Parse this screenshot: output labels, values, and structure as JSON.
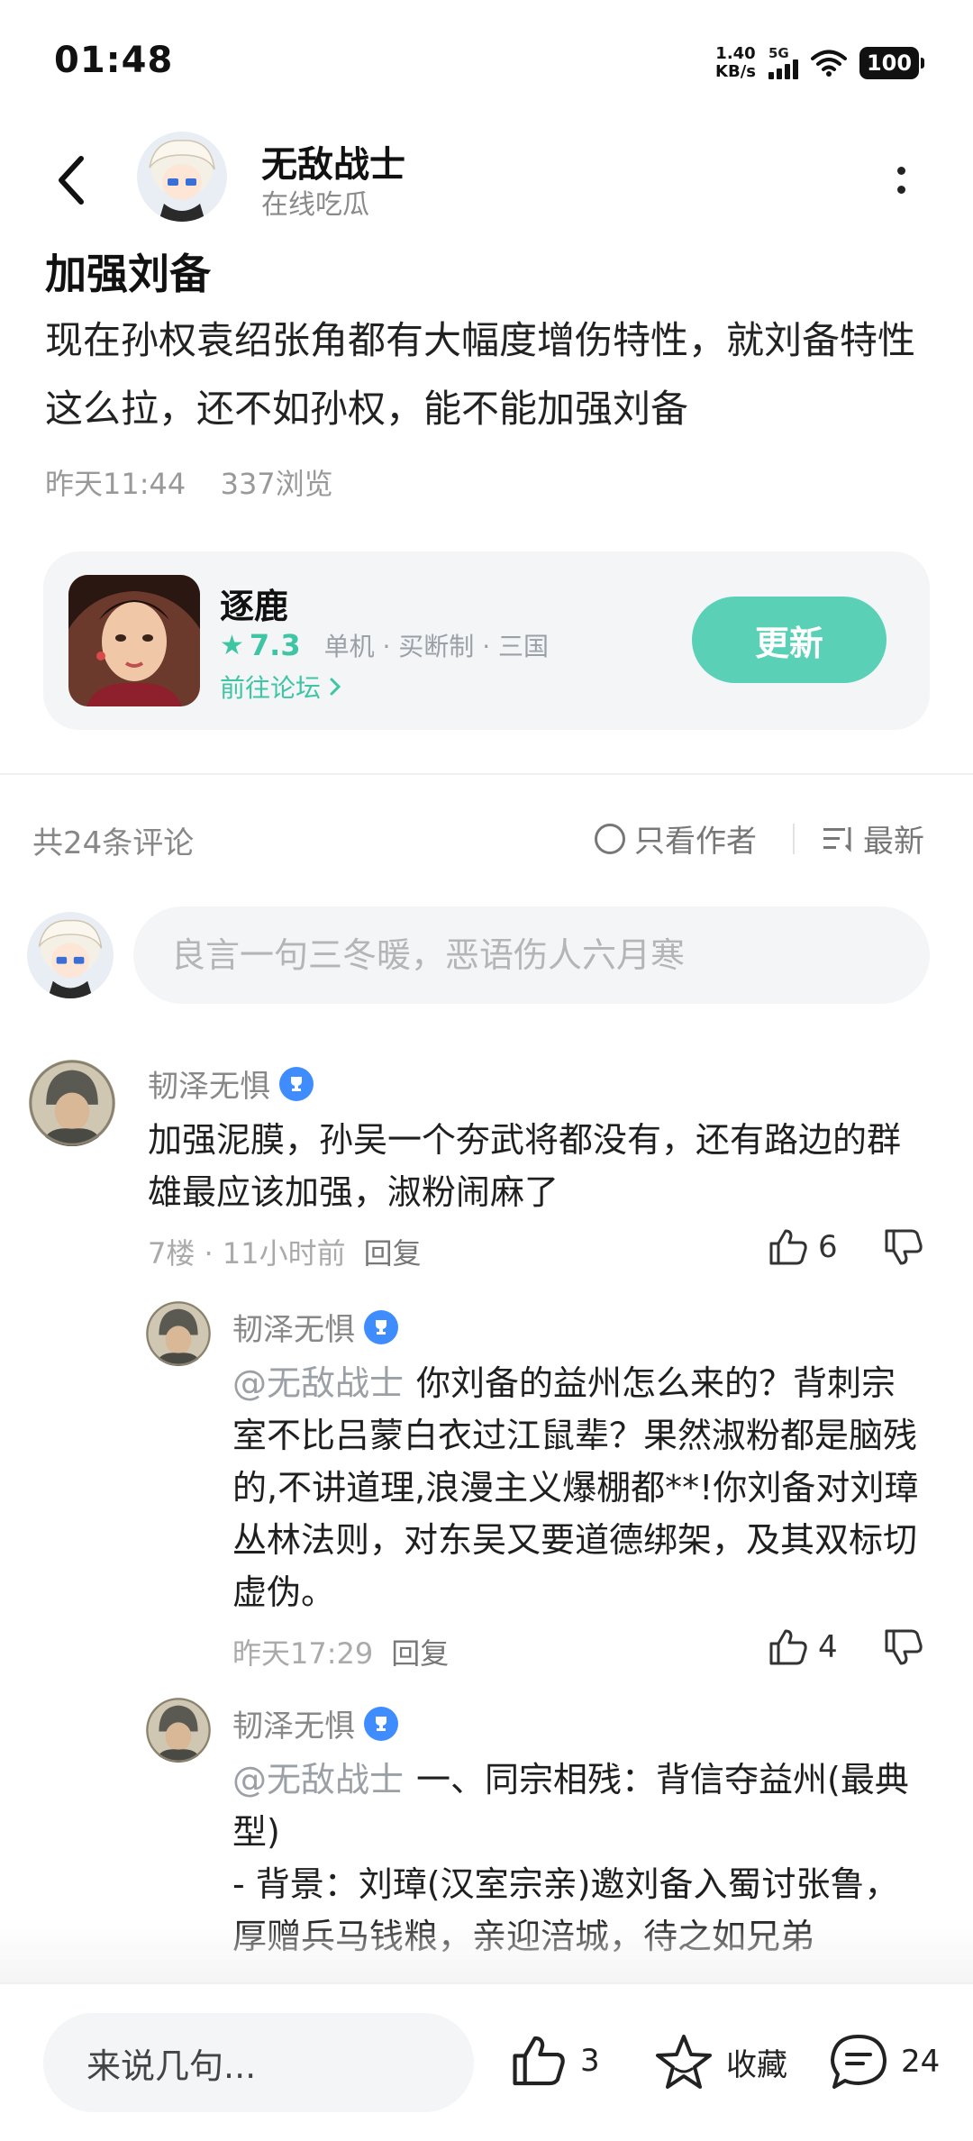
{
  "status_bar": {
    "time": "01:48",
    "speed_value": "1.40",
    "speed_unit": "KB/s",
    "network": "5G",
    "battery": "100"
  },
  "header": {
    "author_name": "无敌战士",
    "author_subtitle": "在线吃瓜"
  },
  "post": {
    "title": "加强刘备",
    "body": "现在孙权袁绍张角都有大幅度增伤特性，就刘备特性这么拉，还不如孙权，能不能加强刘备",
    "time": "昨天11:44",
    "views": "337浏览"
  },
  "game_card": {
    "name": "逐鹿",
    "rating": "7.3",
    "tags": "单机 · 买断制 · 三国",
    "forum_link": "前往论坛",
    "update_label": "更新",
    "accent_color": "#3ec5a4"
  },
  "comments_bar": {
    "count_label": "共24条评论",
    "only_author_label": "只看作者",
    "sort_label": "最新"
  },
  "comment_input": {
    "placeholder": "良言一句三冬暖，恶语伤人六月寒"
  },
  "comments": [
    {
      "user": "韧泽无惧",
      "text": "加强泥膜，孙吴一个夯武将都没有，还有路边的群雄最应该加强，淑粉闹麻了",
      "floor": "7楼",
      "time": "11小时前",
      "reply_label": "回复",
      "likes": "6"
    }
  ],
  "replies": [
    {
      "user": "韧泽无惧",
      "mention": "@无敌战士",
      "text": "你刘备的益州怎么来的？背刺宗室不比吕蒙白衣过江鼠辈？果然淑粉都是脑残的,不讲道理,浪漫主义爆棚都**!你刘备对刘璋丛林法则，对东吴又要道德绑架，及其双标切虚伪。",
      "time": "昨天17:29",
      "reply_label": "回复",
      "likes": "4"
    },
    {
      "user": "韧泽无惧",
      "mention": "@无敌战士",
      "text": "一、同宗相残：背信夺益州(最典型)",
      "text2": "- 背景：刘璋(汉室宗亲)邀刘备入蜀讨张鲁，厚赠兵马钱粮，亲迎涪城，待之如兄弟"
    }
  ],
  "bottom_bar": {
    "say_placeholder": "来说几句...",
    "likes": "3",
    "favorite_label": "收藏",
    "comments": "24"
  }
}
